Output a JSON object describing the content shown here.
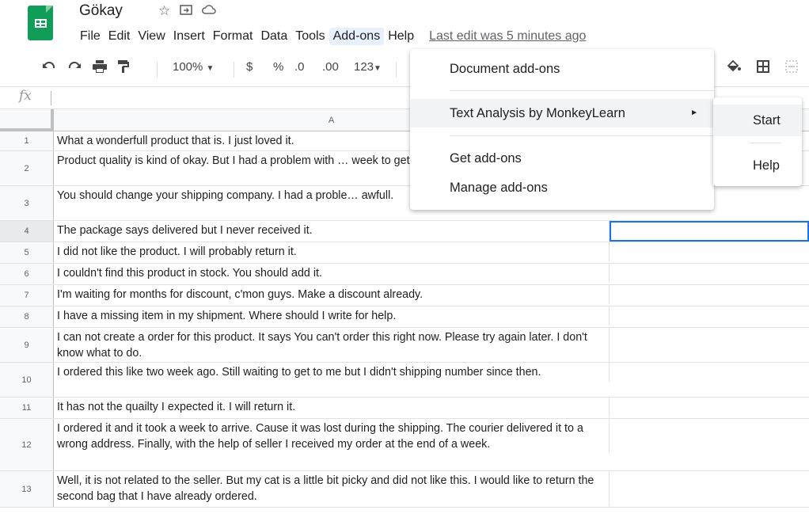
{
  "app": {
    "title": "Gökay",
    "icons": [
      "star-icon",
      "move-to-folder-icon",
      "cloud-status-icon"
    ]
  },
  "menubar": {
    "items": [
      "File",
      "Edit",
      "View",
      "Insert",
      "Format",
      "Data",
      "Tools",
      "Add-ons",
      "Help"
    ],
    "active": "Add-ons",
    "last_edit": "Last edit was 5 minutes ago"
  },
  "toolbar": {
    "zoom": "100%",
    "currency": "$",
    "percent": "%",
    "dec_decrease": ".0",
    "dec_increase": ".00",
    "more_formats": "123"
  },
  "formula_bar": {
    "fx": "fx",
    "value": ""
  },
  "columns": [
    "A"
  ],
  "rows": [
    {
      "num": "1",
      "text": "What a wonderfull product that is. I just loved it."
    },
    {
      "num": "2",
      "text": "Product quality is kind of okay. But I had a problem with … week to get it."
    },
    {
      "num": "3",
      "text": "You should change your shipping company. I had a proble… awfull."
    },
    {
      "num": "4",
      "text": "The package says delivered but I never received it."
    },
    {
      "num": "5",
      "text": "I did not like the product. I will probably return it."
    },
    {
      "num": "6",
      "text": "I couldn't find this product in stock. You should add it."
    },
    {
      "num": "7",
      "text": "I'm waiting for months for discount, c'mon guys. Make a discount already."
    },
    {
      "num": "8",
      "text": "I have a missing item in my shipment. Where should I write for help."
    },
    {
      "num": "9",
      "text": "I can not create a order for this product. It says You can't order this right now. Please try again later. I don't know what to do."
    },
    {
      "num": "10",
      "text": "I ordered this like two week ago. Still waiting to get to me but I didn't shipping number since then."
    },
    {
      "num": "11",
      "text": "It has not the quailty I expected it. I will return it."
    },
    {
      "num": "12",
      "text": "I ordered it and it took a week to arrive. Cause it was lost during the shipping. The courier delivered it to a wrong address. Finally, with the help of seller I received my order at the end of a week."
    },
    {
      "num": "13",
      "text": "Well, it is not related to the seller. But my cat is a little bit picky and did not like this. I would like to return the second bag that I have already ordered."
    }
  ],
  "addons_menu": {
    "items": [
      "Document add-ons",
      "Text Analysis by MonkeyLearn",
      "Get add-ons",
      "Manage add-ons"
    ],
    "highlighted": "Text Analysis by MonkeyLearn"
  },
  "submenu": {
    "items": [
      "Start",
      "Help"
    ],
    "highlighted": "Start"
  },
  "colors": {
    "sheets_green": "#0f9d58",
    "selection_blue": "#1a73e8",
    "menu_highlight": "#f1f3f4",
    "active_menu_bg": "#e8f0fe"
  }
}
